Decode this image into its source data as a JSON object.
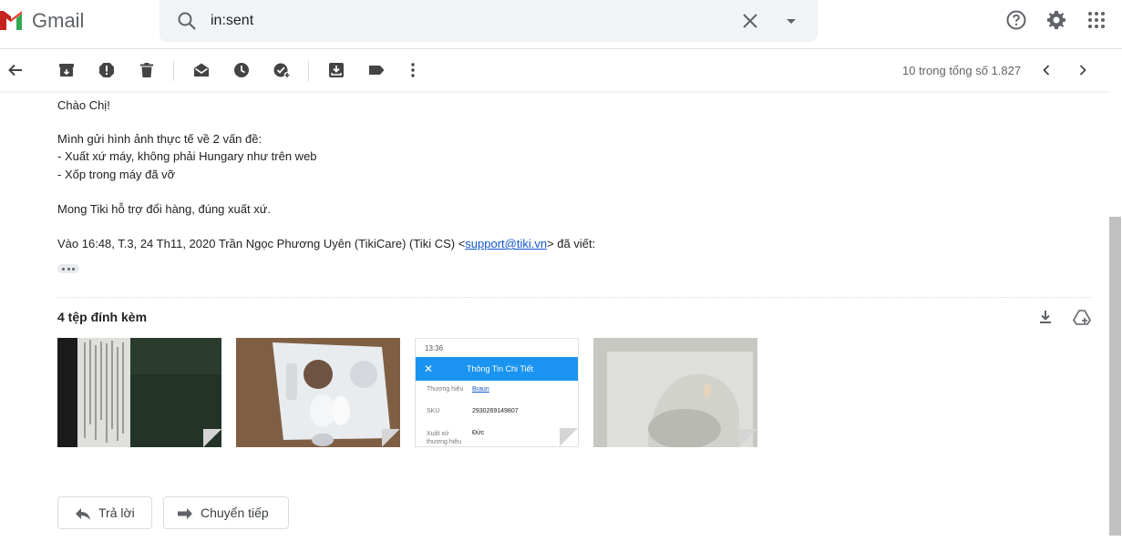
{
  "header": {
    "app_name": "Gmail",
    "search_value": "in:sent",
    "search_icon": "search-icon",
    "help_icon": "help-icon",
    "settings_icon": "gear-icon",
    "apps_icon": "apps-grid-icon"
  },
  "toolbar": {
    "icons": [
      "back-arrow-icon",
      "archive-icon",
      "report-spam-icon",
      "delete-icon",
      "mark-unread-icon",
      "snooze-icon",
      "add-task-icon",
      "move-to-icon",
      "label-icon",
      "more-icon"
    ],
    "pager_text": "10 trong tổng số 1.827"
  },
  "message": {
    "greeting": "Chào Chị!",
    "line1": "Mình gửi hình ảnh thực tế về 2 vấn đề:",
    "line2": "- Xuất xứ máy, không phải Hungary như trên web",
    "line3": "- Xốp trong máy đã vỡ",
    "line4": "Mong Tiki hỗ trợ đổi hàng, đúng xuất xứ.",
    "quote_prefix": "Vào 16:48, T.3, 24 Th11, 2020 Trần Ngọc Phương Uyên (TikiCare) (Tiki CS) <",
    "quote_email": "support@tiki.vn",
    "quote_suffix": "> đã viết:"
  },
  "attachments": {
    "title": "4 tệp đính kèm",
    "phone_screenshot": {
      "status_time": "13:36",
      "title": "Thông Tin Chi Tiết",
      "rows": [
        {
          "label": "Thương hiệu",
          "value": "Braun"
        },
        {
          "label": "SKU",
          "value": "2930269149807"
        },
        {
          "label": "Xuất xứ thương hiệu",
          "value": "Đức"
        }
      ]
    }
  },
  "actions": {
    "reply_label": "Trả lời",
    "forward_label": "Chuyển tiếp"
  },
  "colors": {
    "link": "#1155cc",
    "search_bg": "#f1f3f4",
    "phone_header": "#1a94f0"
  }
}
